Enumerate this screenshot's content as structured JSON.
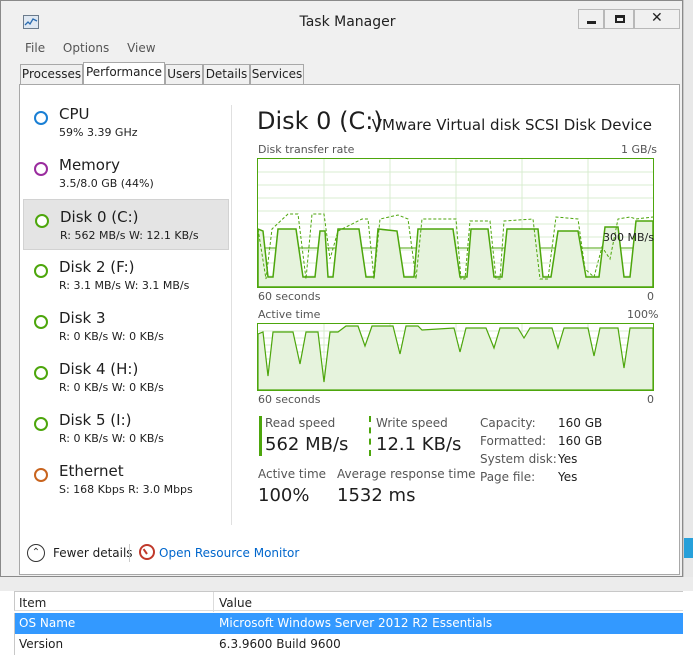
{
  "window": {
    "title": "Task Manager",
    "icon": "task-manager-icon"
  },
  "menu": [
    "File",
    "Options",
    "View"
  ],
  "tabs": [
    {
      "label": "Processes",
      "active": false
    },
    {
      "label": "Performance",
      "active": true
    },
    {
      "label": "Users",
      "active": false
    },
    {
      "label": "Details",
      "active": false
    },
    {
      "label": "Services",
      "active": false
    }
  ],
  "sidebar": {
    "items": [
      {
        "name": "CPU",
        "sub": "59%  3.39 GHz",
        "color": "#1a7fd4",
        "selected": false
      },
      {
        "name": "Memory",
        "sub": "3.5/8.0 GB (44%)",
        "color": "#9a2c9e",
        "selected": false
      },
      {
        "name": "Disk 0 (C:)",
        "sub": "R: 562 MB/s  W: 12.1 KB/s",
        "color": "#4da60c",
        "selected": true
      },
      {
        "name": "Disk 2 (F:)",
        "sub": "R: 3.1 MB/s  W: 3.1 MB/s",
        "color": "#4da60c",
        "selected": false
      },
      {
        "name": "Disk 3",
        "sub": "R: 0 KB/s  W: 0 KB/s",
        "color": "#4da60c",
        "selected": false
      },
      {
        "name": "Disk 4 (H:)",
        "sub": "R: 0 KB/s  W: 0 KB/s",
        "color": "#4da60c",
        "selected": false
      },
      {
        "name": "Disk 5 (I:)",
        "sub": "R: 0 KB/s  W: 0 KB/s",
        "color": "#4da60c",
        "selected": false
      },
      {
        "name": "Ethernet",
        "sub": "S: 168 Kbps  R: 3.0 Mbps",
        "color": "#c8641e",
        "selected": false
      }
    ]
  },
  "main": {
    "heading": "Disk 0 (C:)",
    "device": "VMware Virtual disk SCSI Disk Device",
    "transfer_graph": {
      "label": "Disk transfer rate",
      "max_label": "1 GB/s",
      "mid_label": "300 MB/s",
      "time_label": "60 seconds",
      "zero_label": "0"
    },
    "active_graph": {
      "label": "Active time",
      "max_label": "100%",
      "time_label": "60 seconds",
      "zero_label": "0"
    },
    "stats": {
      "read_speed_label": "Read speed",
      "read_speed": "562 MB/s",
      "write_speed_label": "Write speed",
      "write_speed": "12.1 KB/s",
      "active_time_label": "Active time",
      "active_time": "100%",
      "avg_response_label": "Average response time",
      "avg_response": "1532 ms"
    },
    "properties": [
      {
        "label": "Capacity:",
        "value": "160 GB"
      },
      {
        "label": "Formatted:",
        "value": "160 GB"
      },
      {
        "label": "System disk:",
        "value": "Yes"
      },
      {
        "label": "Page file:",
        "value": "Yes"
      }
    ]
  },
  "footer": {
    "fewer_details": "Fewer details",
    "resource_monitor": "Open Resource Monitor"
  },
  "background_table": {
    "headers": [
      "Item",
      "Value"
    ],
    "rows": [
      {
        "item": "OS Name",
        "value": "Microsoft Windows Server 2012 R2 Essentials"
      },
      {
        "item": "Version",
        "value": "6.3.9600 Build 9600"
      }
    ]
  }
}
